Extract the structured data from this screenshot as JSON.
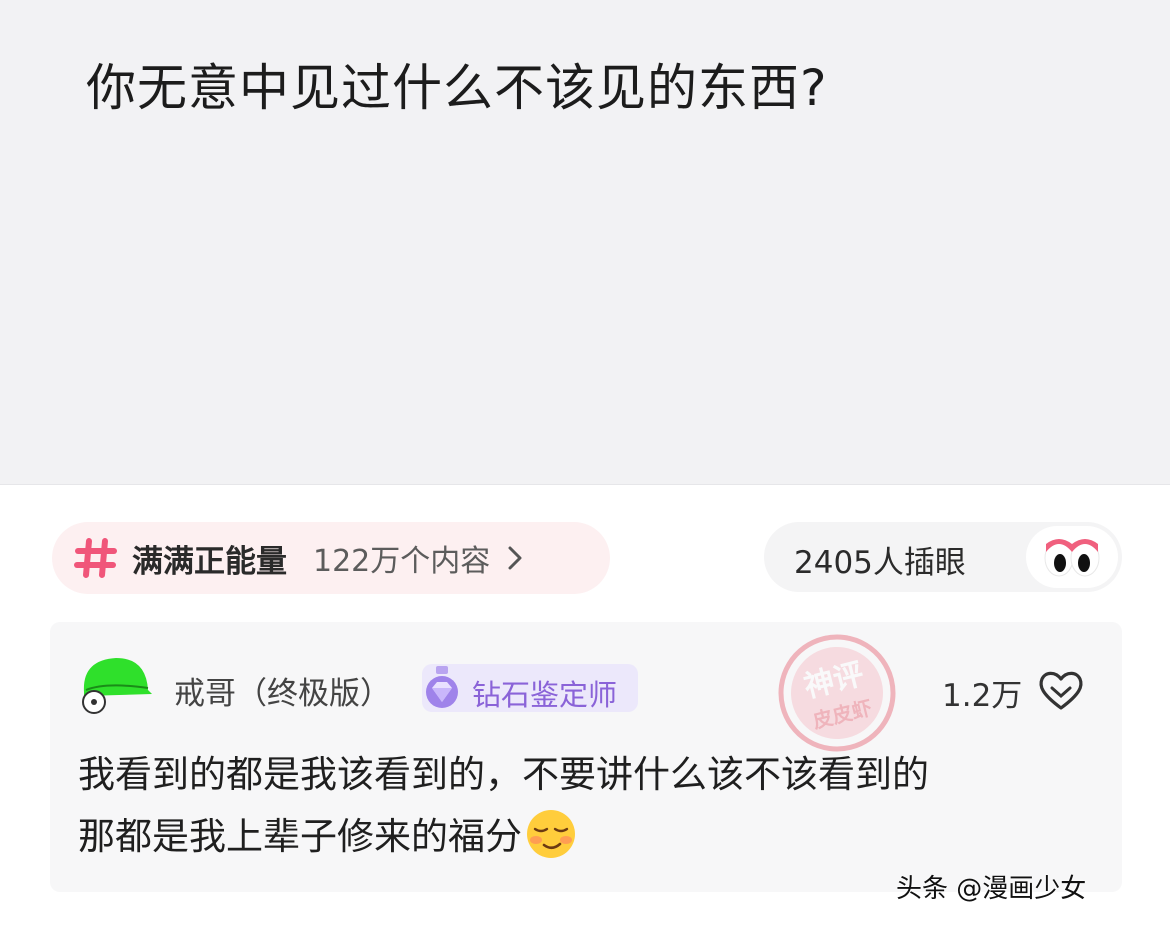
{
  "question": {
    "title": "你无意中见过什么不该见的东西?"
  },
  "topic": {
    "icon": "hashtag-icon",
    "name": "满满正能量",
    "count": "122万个内容",
    "accent_color": "#f0567a"
  },
  "peek": {
    "label": "2405人插眼",
    "icon": "eyes-icon"
  },
  "comment": {
    "avatar_icon": "green-helmet-avatar",
    "username": "戒哥（终极版）",
    "badge": {
      "icon": "diamond-icon",
      "label": "钻石鉴定师",
      "color": "#8a63d8"
    },
    "stamp_lines": [
      "神评",
      "皮皮虾"
    ],
    "likes": "1.2万",
    "like_icon": "heart-outline-icon",
    "text_lines": [
      "我看到的都是我该看到的，不要讲什么该不该看到的",
      "那都是我上辈子修来的福分"
    ],
    "emoji_icon": "smug-smile-emoji"
  },
  "watermark": {
    "text": "头条 @漫画少女"
  }
}
